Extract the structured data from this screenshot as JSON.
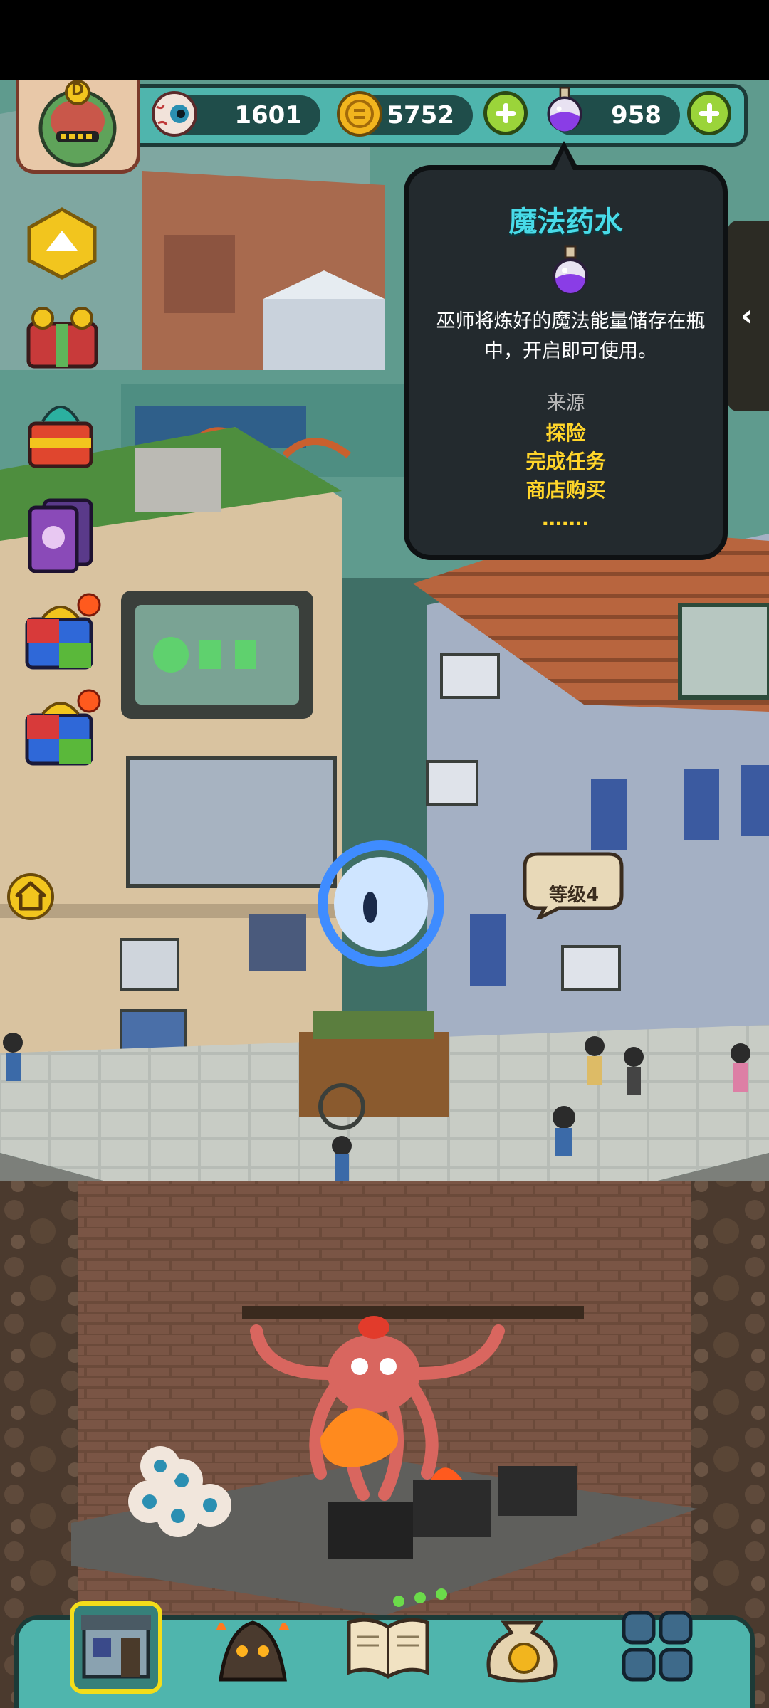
{
  "resources": {
    "eyeballs": "1601",
    "coins": "5752",
    "potions": "958"
  },
  "avatar": {
    "badge": "D"
  },
  "tooltip": {
    "title": "魔法药水",
    "description": "巫师将炼好的魔法能量储存在瓶中，开启即可使用。",
    "source_label": "来源",
    "sources": [
      "探险",
      "完成任务",
      "商店购买",
      "……."
    ]
  },
  "scene": {
    "level_bubble": "等级4"
  },
  "icons": {
    "eyeball": "eyeball-icon",
    "coin": "gold-coin-icon",
    "potion": "magic-potion-icon",
    "plus": "plus-icon",
    "home": "home-icon",
    "collapse": "chevron-up-icon",
    "side_tab": "chevron-left-icon"
  },
  "colors": {
    "panel_teal": "#4fb5ad",
    "tooltip_title": "#48dbe8",
    "tooltip_source": "#ffd52a",
    "plus_green": "#9bd43a",
    "active_nav": "#f3dd1a"
  }
}
